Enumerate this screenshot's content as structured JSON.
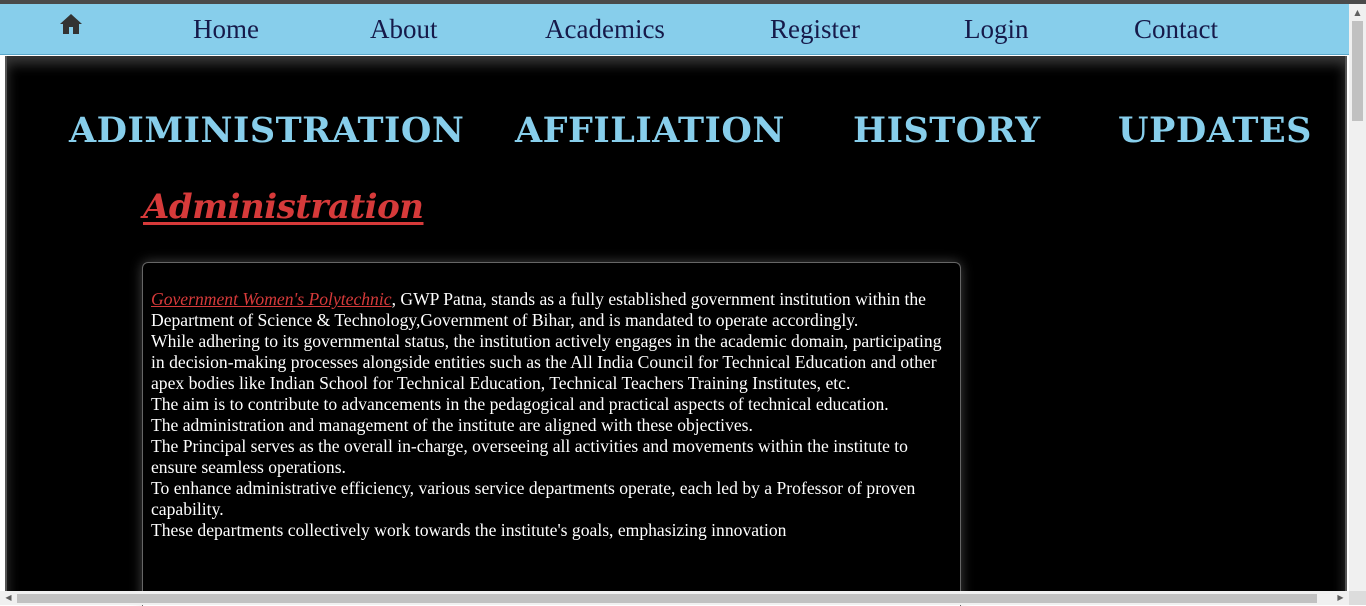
{
  "navbar": {
    "home_icon": "home-icon",
    "links": [
      "Home",
      "About",
      "Academics",
      "Register",
      "Login",
      "Contact"
    ]
  },
  "section_tabs": [
    "ADIMINISTRATION",
    "AFFILIATION",
    "HISTORY",
    "UPDATES"
  ],
  "heading": "Administration ",
  "content": {
    "link_text": "Government Women's Polytechnic",
    "lead_rest": ", GWP Patna, stands as a fully established government institution within the Department of Science & Technology,Government of Bihar, and is mandated to operate accordingly.",
    "paragraphs": [
      "While adhering to its governmental status, the institution actively engages in the academic domain, participating in decision-making processes alongside entities such as the All India Council for Technical Education and other apex bodies like Indian School for Technical Education, Technical Teachers Training Institutes, etc.",
      "The aim is to contribute to advancements in the pedagogical and practical aspects of technical education.",
      "The administration and management of the institute are aligned with these objectives.",
      "The Principal serves as the overall in-charge, overseeing all activities and movements within the institute to ensure seamless operations.",
      "To enhance administrative efficiency, various service departments operate, each led by a Professor of proven capability.",
      "These departments collectively work towards the institute's goals, emphasizing innovation"
    ]
  },
  "colors": {
    "navbar_bg": "#87ceeb",
    "nav_text": "#161a4a",
    "tab_text": "#87ceeb",
    "heading": "#d63a3a",
    "page_bg": "#000000"
  }
}
